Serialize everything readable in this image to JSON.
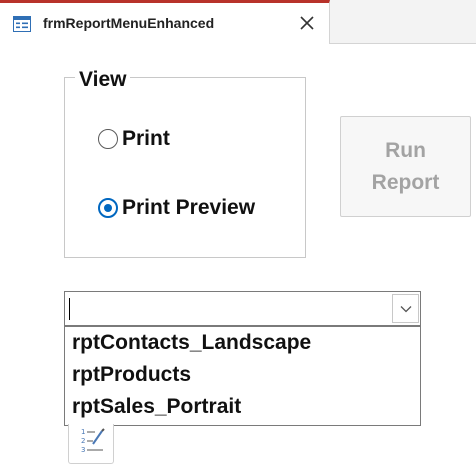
{
  "tab": {
    "title": "frmReportMenuEnhanced",
    "icon": "form-icon",
    "close_icon": "close-icon",
    "accent_color": "#b8322a"
  },
  "view_group": {
    "label": "View",
    "options": [
      {
        "label": "Print",
        "selected": false
      },
      {
        "label": "Print Preview",
        "selected": true
      }
    ],
    "selected_color": "#0067c0"
  },
  "run_button": {
    "label": "Run\nReport",
    "enabled": false
  },
  "report_combo": {
    "value": "",
    "dropdown_icon": "chevron-down-icon",
    "items": [
      "rptContacts_Landscape",
      "rptProducts",
      "rptSales_Portrait"
    ]
  },
  "tab_order_icon": "numbered-list-edit-icon"
}
